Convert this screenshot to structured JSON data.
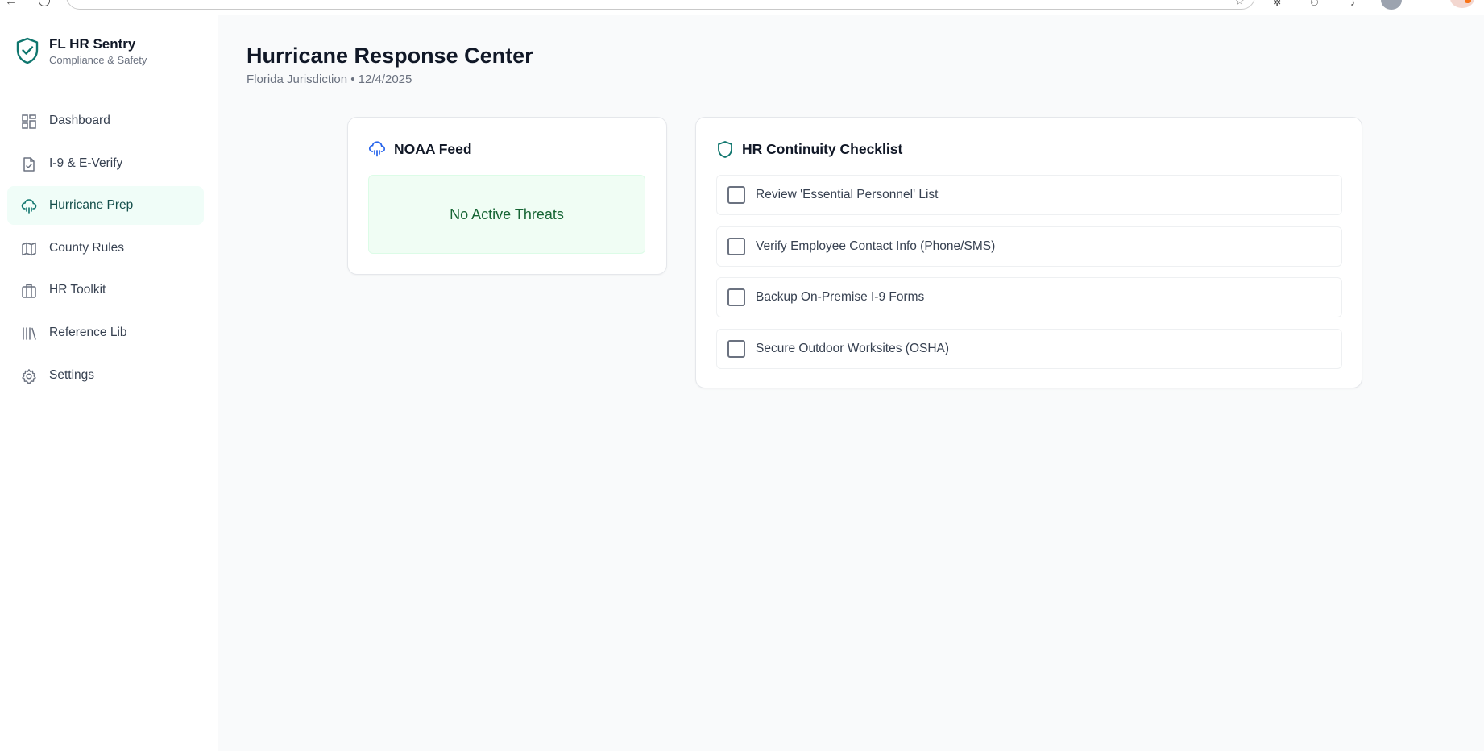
{
  "app": {
    "name": "FL HR Sentry",
    "tagline": "Compliance & Safety"
  },
  "sidebar": {
    "items": [
      {
        "label": "Dashboard",
        "icon": "grid-icon",
        "active": false
      },
      {
        "label": "I-9 & E-Verify",
        "icon": "file-check-icon",
        "active": false
      },
      {
        "label": "Hurricane Prep",
        "icon": "cloud-rain-icon",
        "active": true
      },
      {
        "label": "County Rules",
        "icon": "map-icon",
        "active": false
      },
      {
        "label": "HR Toolkit",
        "icon": "briefcase-icon",
        "active": false
      },
      {
        "label": "Reference Lib",
        "icon": "library-icon",
        "active": false
      },
      {
        "label": "Settings",
        "icon": "gear-icon",
        "active": false
      }
    ]
  },
  "header": {
    "title": "Hurricane Response Center",
    "subtitle": "Florida Jurisdiction • 12/4/2025"
  },
  "noaa": {
    "title": "NOAA Feed",
    "status": "No Active Threats"
  },
  "checklist": {
    "title": "HR Continuity Checklist",
    "items": [
      {
        "label": "Review 'Essential Personnel' List",
        "checked": false
      },
      {
        "label": "Verify Employee Contact Info (Phone/SMS)",
        "checked": false
      },
      {
        "label": "Backup On-Premise I-9 Forms",
        "checked": false
      },
      {
        "label": "Secure Outdoor Worksites (OSHA)",
        "checked": false
      }
    ]
  },
  "colors": {
    "accent": "#0f766e",
    "active_bg": "#f0fdf8",
    "status_bg": "#f0fdf4",
    "status_text": "#166534"
  }
}
